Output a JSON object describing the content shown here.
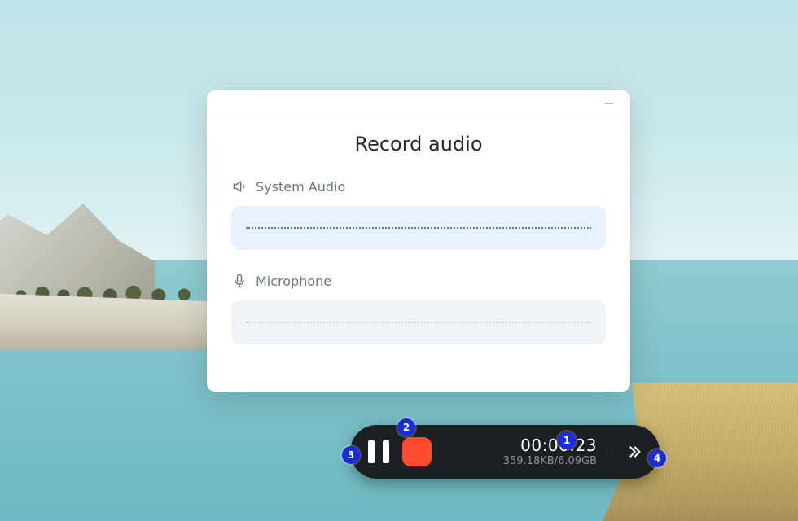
{
  "window": {
    "title": "Record audio",
    "sections": {
      "system_audio_label": "System Audio",
      "microphone_label": "Microphone"
    }
  },
  "rec_bar": {
    "elapsed": "00:00:23",
    "file_size": "359.18KB",
    "capacity": "6.09GB",
    "size_sep": "/"
  },
  "annotations": {
    "b1": "1",
    "b2": "2",
    "b3": "3",
    "b4": "4"
  },
  "icons": {
    "speaker": "speaker-icon",
    "microphone": "microphone-icon",
    "minimize": "minimize-icon",
    "pause": "pause-icon",
    "stop": "stop-icon",
    "expand": "chevrons-right-icon"
  },
  "colors": {
    "accent_stop": "#ff4a2e",
    "badge": "#1a2bd8",
    "system_wave_bg": "#e8f1fc",
    "mic_wave_bg": "#f2f3f4"
  }
}
